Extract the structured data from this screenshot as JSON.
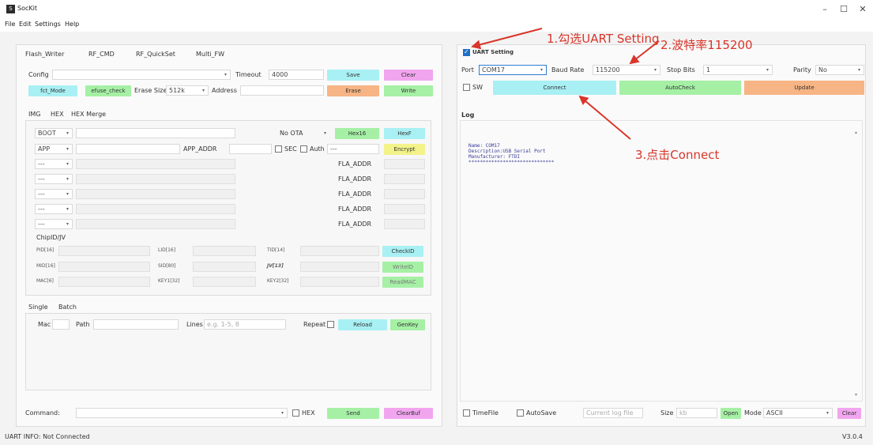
{
  "window": {
    "title": "SocKit",
    "icon_letter": "S",
    "minimize": "–",
    "maximize": "☐",
    "close": "✕"
  },
  "menu": [
    "File",
    "Edit",
    "Settings",
    "Help"
  ],
  "main_tabs": [
    "Flash_Writer",
    "RF_CMD",
    "RF_QuickSet",
    "Multi_FW"
  ],
  "flash": {
    "config_label": "Config",
    "timeout_label": "Timeout",
    "timeout_value": "4000",
    "save": "Save",
    "clear": "Clear",
    "fct_mode": "fct_Mode",
    "efuse_check": "efuse_check",
    "erase_size_label": "Erase Size",
    "erase_size_value": "512k",
    "address_label": "Address",
    "erase": "Erase",
    "write": "Write"
  },
  "img_tabs": [
    "IMG",
    "HEX",
    "HEX Merge"
  ],
  "img_rows": {
    "boot": "BOOT",
    "app": "APP",
    "dash": "---",
    "no_ota": "No OTA",
    "hex16": "Hex16",
    "hexf": "HexF",
    "app_addr": "APP_ADDR",
    "sec": "SEC",
    "auth": "Auth",
    "auth_value": "---",
    "encrypt": "Encrypt",
    "fla_addr": "FLA_ADDR"
  },
  "chipid": {
    "group_label": "ChipID/JV",
    "fields": [
      {
        "a": "PID[16]",
        "b": "LID[16]",
        "c": "TID[14]"
      },
      {
        "a": "MID[16]",
        "b": "SID[80]",
        "c": "JV[13]"
      },
      {
        "a": "MAC[6]",
        "b": "KEY1[32]",
        "c": "KEY2[32]"
      }
    ],
    "buttons": [
      "CheckID",
      "WriteID",
      "ReadMAC"
    ]
  },
  "single_tabs": [
    "Single",
    "Batch"
  ],
  "single": {
    "mac_label": "Mac",
    "path_label": "Path",
    "lines_label": "Lines",
    "lines_placeholder": "e.g. 1-5, 8",
    "repeat_label": "Repeat",
    "reload": "Reload",
    "genkey": "GenKey"
  },
  "command": {
    "label": "Command:",
    "hex_label": "HEX",
    "send": "Send",
    "clearbuf": "ClearBuf"
  },
  "uart": {
    "setting_label": "UART Setting",
    "setting_checked": true,
    "port_label": "Port",
    "port_value": "COM17",
    "baud_label": "Baud Rate",
    "baud_value": "115200",
    "stop_label": "Stop Bits",
    "stop_value": "1",
    "parity_label": "Parity",
    "parity_value": "No",
    "sw_label": "SW",
    "connect": "Connect",
    "autocheck": "AutoCheck",
    "update": "Update"
  },
  "log": {
    "label": "Log",
    "lines": [
      "Name: COM17",
      "Description:USB Serial Port",
      "Manufacturer: FTDI",
      "******************************"
    ]
  },
  "log_toolbar": {
    "timefile": "TimeFile",
    "autosave": "AutoSave",
    "log_file_placeholder": "Current log file",
    "size_label": "Size",
    "size_placeholder": "kb",
    "open": "Open",
    "mode_label": "Mode",
    "mode_value": "ASCII",
    "clear": "Clear"
  },
  "status": {
    "info": "UART INFO: Not Connected",
    "version": "V3.0.4"
  },
  "annotations": {
    "step1": "1.勾选UART Setting",
    "step2": "2.波特率115200",
    "step3": "3.点击Connect"
  },
  "colors": {
    "cyan": "#a8f0f3",
    "pink": "#f1a5ef",
    "green": "#a5f0a5",
    "orange": "#f7b484",
    "yellow": "#f3f38a",
    "annotation_red": "#d9352a"
  }
}
